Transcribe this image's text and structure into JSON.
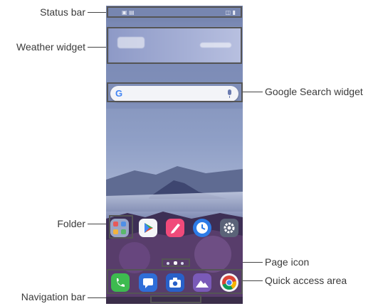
{
  "callouts": {
    "status_bar": "Status bar",
    "weather_widget": "Weather widget",
    "google_search_widget": "Google Search widget",
    "folder": "Folder",
    "page_icon": "Page icon",
    "quick_access_area": "Quick access area",
    "navigation_bar": "Navigation bar"
  },
  "search": {
    "logo": "G"
  },
  "home_icons": [
    {
      "name": "folder-icon"
    },
    {
      "name": "play-store-icon"
    },
    {
      "name": "memo-icon"
    },
    {
      "name": "clock-icon"
    },
    {
      "name": "settings-icon"
    }
  ],
  "dock_icons": [
    {
      "name": "phone-icon"
    },
    {
      "name": "messages-icon"
    },
    {
      "name": "camera-icon"
    },
    {
      "name": "gallery-icon"
    },
    {
      "name": "chrome-icon"
    }
  ],
  "colors": {
    "sky": "#7c8bb6",
    "accent_phone": "#3dbb4f",
    "accent_messages": "#2f6ed8",
    "accent_memo": "#f04a7a",
    "accent_clock": "#2d7be6",
    "accent_settings": "#5a6378",
    "accent_camera": "#2860c9",
    "accent_gallery": "#7a5ab8"
  }
}
